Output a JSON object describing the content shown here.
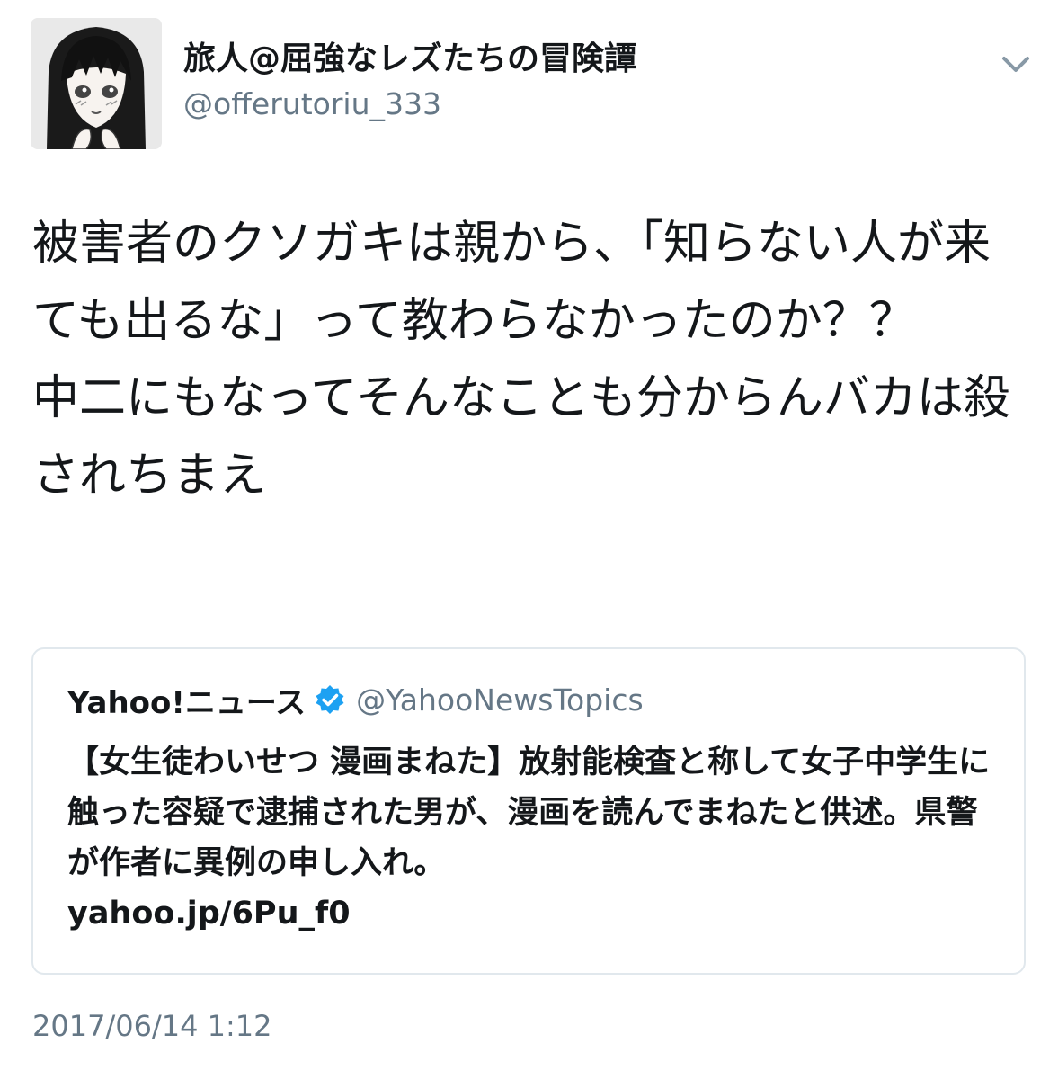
{
  "author": {
    "display_name": "旅人@屈強なレズたちの冒険譚",
    "handle": "@offerutoriu_333",
    "avatar_icon": "manga-girl-avatar"
  },
  "menu": {
    "icon": "chevron-down-icon"
  },
  "tweet": {
    "text": "被害者のクソガキは親から、「知らない人が来ても出るな」って教わらなかったのか？？\n中二にもなってそんなことも分からんバカは殺されちまえ"
  },
  "quoted_tweet": {
    "name": "Yahoo!ニュース",
    "verified_icon": "verified-badge-icon",
    "handle": "@YahooNewsTopics",
    "text": "【女生徒わいせつ 漫画まねた】放射能検査と称して女子中学生に触った容疑で逮捕された男が、漫画を読んでまねたと供述。県警が作者に異例の申し入れ。\nyahoo.jp/6Pu_f0"
  },
  "timestamp": "2017/06/14 1:12",
  "colors": {
    "text": "#14171a",
    "secondary": "#657786",
    "border": "#e1e8ed",
    "verified": "#1da1f2"
  }
}
